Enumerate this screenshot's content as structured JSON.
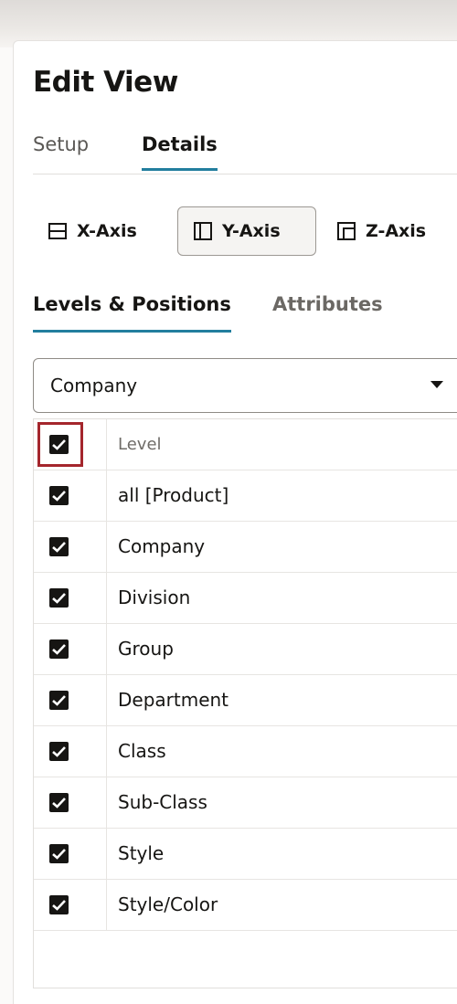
{
  "panel": {
    "title": "Edit View"
  },
  "main_tabs": [
    {
      "label": "Setup",
      "active": false
    },
    {
      "label": "Details",
      "active": true
    }
  ],
  "axis_buttons": [
    {
      "label": "X-Axis",
      "icon": "x-axis-icon",
      "active": false
    },
    {
      "label": "Y-Axis",
      "icon": "y-axis-icon",
      "active": true
    },
    {
      "label": "Z-Axis",
      "icon": "z-axis-icon",
      "active": false
    }
  ],
  "sub_tabs": [
    {
      "label": "Levels & Positions",
      "active": true
    },
    {
      "label": "Attributes",
      "active": false
    }
  ],
  "hierarchy_select": {
    "value": "Company"
  },
  "levels_table": {
    "header": {
      "label": "Level",
      "checked": true,
      "highlighted": true
    },
    "rows": [
      {
        "label": "all [Product]",
        "checked": true
      },
      {
        "label": "Company",
        "checked": true
      },
      {
        "label": "Division",
        "checked": true
      },
      {
        "label": "Group",
        "checked": true
      },
      {
        "label": "Department",
        "checked": true
      },
      {
        "label": "Class",
        "checked": true
      },
      {
        "label": "Sub-Class",
        "checked": true
      },
      {
        "label": "Style",
        "checked": true
      },
      {
        "label": "Style/Color",
        "checked": true
      }
    ]
  },
  "colors": {
    "accent_underline": "#227e9e",
    "checkbox_fill": "#161513",
    "highlight_border": "#a4262c"
  }
}
